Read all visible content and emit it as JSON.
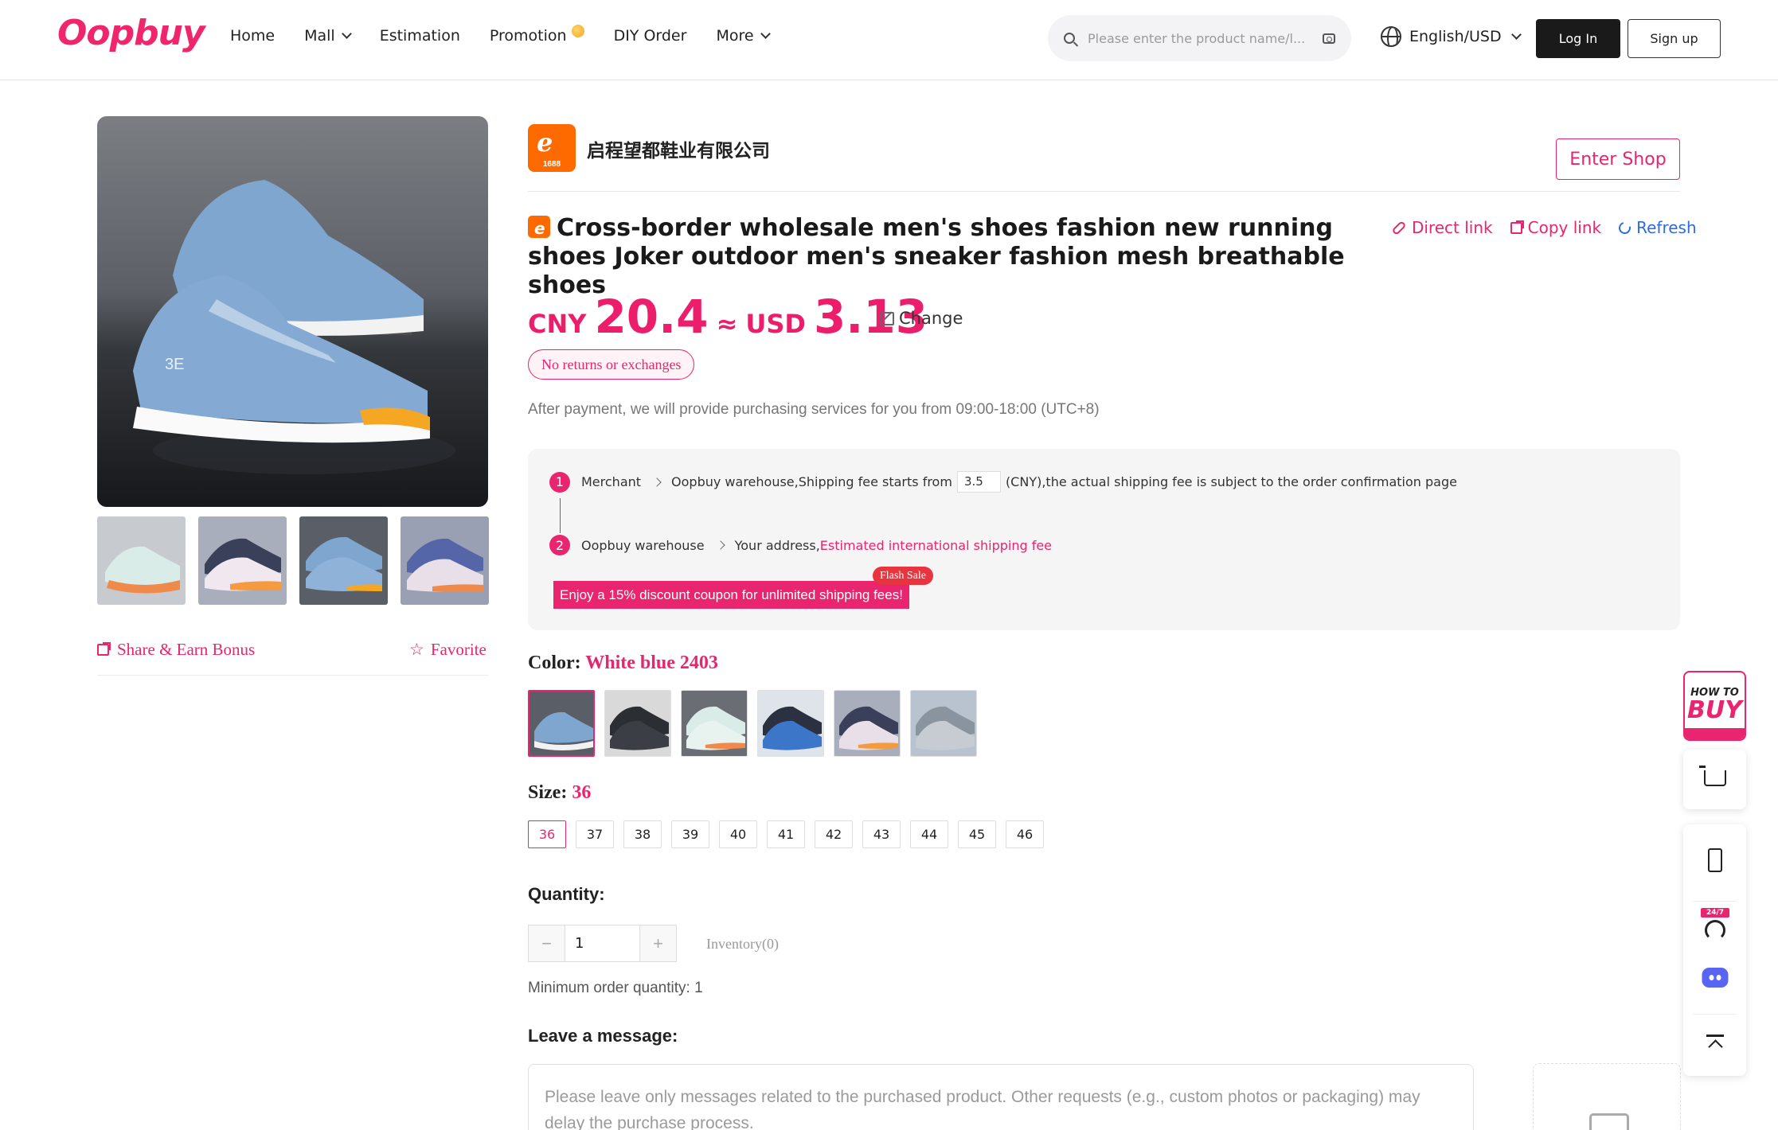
{
  "header": {
    "logo": "Oopbuy",
    "nav": [
      {
        "label": "Home"
      },
      {
        "label": "Mall"
      },
      {
        "label": "Estimation"
      },
      {
        "label": "Promotion"
      },
      {
        "label": "DIY Order"
      },
      {
        "label": "More"
      }
    ],
    "search_placeholder": "Please enter the product name/l...",
    "language": "English/USD",
    "login": "Log In",
    "signup": "Sign up"
  },
  "gallery": {
    "share": "Share & Earn Bonus",
    "favorite": "Favorite"
  },
  "shop": {
    "logo_text": "1688",
    "name": "启程望都鞋业有限公司",
    "enter": "Enter Shop"
  },
  "product": {
    "title": "Cross-border wholesale men's shoes fashion new running shoes Joker outdoor men's sneaker fashion mesh breathable shoes",
    "links": {
      "direct": "Direct link",
      "copy": "Copy link",
      "refresh": "Refresh"
    },
    "price": {
      "cny_label": "CNY",
      "cny": "20.4",
      "approx": "≈",
      "usd_label": "USD",
      "usd": "3.13",
      "change": "Change"
    },
    "no_returns": "No returns or exchanges",
    "after_payment": "After payment, we will provide purchasing services for you from 09:00-18:00 (UTC+8)"
  },
  "shipping": {
    "step1": {
      "num": "1",
      "from": "Merchant",
      "to_text": "Oopbuy warehouse,Shipping fee starts from",
      "fee": "3.5",
      "suffix": "(CNY),the actual shipping fee is subject to the order confirmation page"
    },
    "step2": {
      "num": "2",
      "from": "Oopbuy warehouse",
      "to_text": "Your address,",
      "link": "Estimated international shipping fee"
    },
    "coupon": "Enjoy a 15% discount coupon for unlimited shipping fees!",
    "flash": "Flash Sale"
  },
  "color": {
    "label": "Color:",
    "selected": "White blue 2403"
  },
  "size": {
    "label": "Size:",
    "selected": "36",
    "options": [
      "36",
      "37",
      "38",
      "39",
      "40",
      "41",
      "42",
      "43",
      "44",
      "45",
      "46"
    ]
  },
  "quantity": {
    "label": "Quantity:",
    "value": "1",
    "minus": "−",
    "plus": "+",
    "inventory": "Inventory(0)",
    "min_order": "Minimum order quantity:  1"
  },
  "message": {
    "label": "Leave a message:",
    "placeholder": "Please leave only messages related to the purchased product. Other requests (e.g., custom photos or packaging) may delay the purchase process."
  },
  "float_bar": {
    "howto_line1": "HOW TO",
    "howto_line2": "BUY",
    "support_badge": "24/7"
  },
  "colors": {
    "accent": "#e8256e",
    "price": "#ec1e6b",
    "link_blue": "#2f6bdf",
    "shop_orange": "#ff6a00"
  }
}
